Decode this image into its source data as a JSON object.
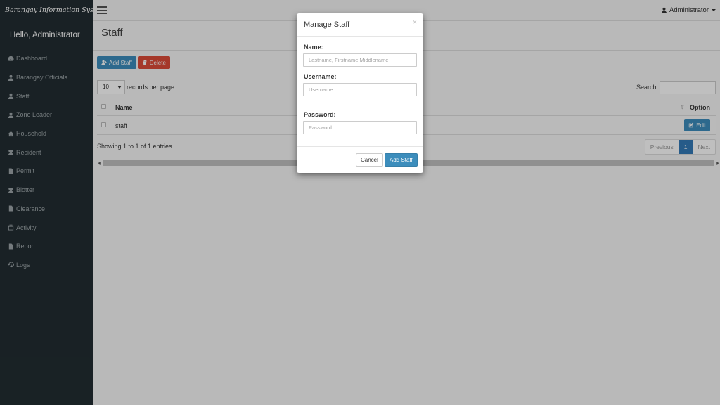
{
  "app": {
    "brand": "Barangay Information System",
    "greeting": "Hello, Administrator",
    "user_menu": "Administrator"
  },
  "sidebar": {
    "items": [
      {
        "label": "Dashboard",
        "icon": "dashboard-icon"
      },
      {
        "label": "Barangay Officials",
        "icon": "user-icon"
      },
      {
        "label": "Staff",
        "icon": "user-icon"
      },
      {
        "label": "Zone Leader",
        "icon": "user-icon"
      },
      {
        "label": "Household",
        "icon": "home-icon"
      },
      {
        "label": "Resident",
        "icon": "users-icon"
      },
      {
        "label": "Permit",
        "icon": "file-icon"
      },
      {
        "label": "Blotter",
        "icon": "users-icon"
      },
      {
        "label": "Clearance",
        "icon": "file-icon"
      },
      {
        "label": "Activity",
        "icon": "calendar-icon"
      },
      {
        "label": "Report",
        "icon": "file-icon"
      },
      {
        "label": "Logs",
        "icon": "history-icon"
      }
    ]
  },
  "page": {
    "title": "Staff",
    "add_button": "Add Staff",
    "delete_button": "Delete"
  },
  "datatable": {
    "length_value": "10",
    "length_label": "records per page",
    "search_label": "Search:",
    "columns": [
      "Name",
      "Option"
    ],
    "rows": [
      {
        "name": "staff",
        "action": "Edit"
      }
    ],
    "info": "Showing 1 to 1 of 1 entries",
    "pagination": {
      "previous": "Previous",
      "current": "1",
      "next": "Next"
    }
  },
  "modal": {
    "title": "Manage Staff",
    "close": "×",
    "fields": {
      "name": {
        "label": "Name:",
        "placeholder": "Lastname, Firstname Middlename"
      },
      "username": {
        "label": "Username:",
        "placeholder": "Username"
      },
      "password": {
        "label": "Password:",
        "placeholder": "Password"
      }
    },
    "cancel_button": "Cancel",
    "submit_button": "Add Staff"
  },
  "colors": {
    "sidebar_bg": "#222d32",
    "primary": "#3c8dbc",
    "danger": "#dd4b39",
    "page_active": "#337ab7"
  }
}
